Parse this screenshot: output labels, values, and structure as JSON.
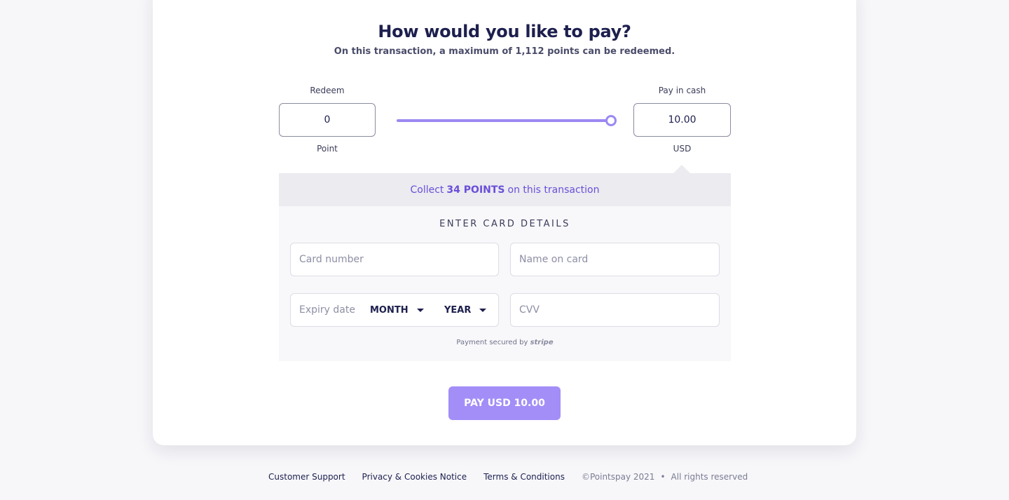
{
  "header": {
    "title": "How would you like to pay?",
    "subtitle": "On this transaction, a maximum of 1,112 points can be redeemed."
  },
  "redeem": {
    "label": "Redeem",
    "value": "0",
    "unit": "Point"
  },
  "cash": {
    "label": "Pay in cash",
    "value": "10.00",
    "unit": "USD"
  },
  "slider": {
    "level_percent": 100,
    "accent": "#9c88f2"
  },
  "collect": {
    "prefix": "Collect",
    "points": "34 POINTS",
    "suffix": "on this transaction"
  },
  "card_form": {
    "title": "ENTER CARD DETAILS",
    "card_number_placeholder": "Card number",
    "name_placeholder": "Name on card",
    "expiry_label": "Expiry date",
    "month_value": "MONTH",
    "year_value": "YEAR",
    "cvv_placeholder": "CVV",
    "secured_prefix": "Payment secured by",
    "secured_brand": "stripe"
  },
  "pay_button": {
    "label": "PAY USD 10.00",
    "color": "#a38ef8"
  },
  "footer": {
    "links": [
      "Customer Support",
      "Privacy & Cookies Notice",
      "Terms & Conditions"
    ],
    "copyright": "©Pointspay 2021",
    "rights": "All rights reserved"
  }
}
